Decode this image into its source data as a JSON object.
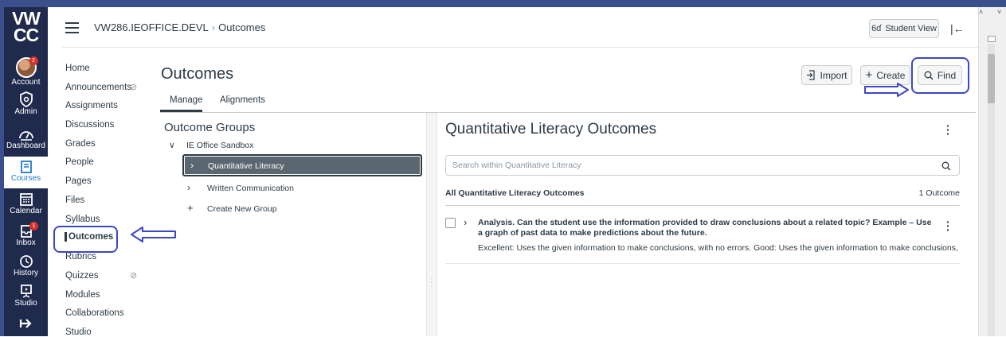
{
  "global_nav": {
    "logo": "VWCC",
    "items": [
      {
        "label": "Account",
        "icon": "avatar",
        "badge": "2"
      },
      {
        "label": "Admin",
        "icon": "shield-icon"
      },
      {
        "label": "Dashboard",
        "icon": "dashboard-icon"
      },
      {
        "label": "Courses",
        "icon": "book-icon",
        "active": true
      },
      {
        "label": "Calendar",
        "icon": "calendar-icon"
      },
      {
        "label": "Inbox",
        "icon": "inbox-icon",
        "badge": "1"
      },
      {
        "label": "History",
        "icon": "clock-icon"
      },
      {
        "label": "Studio",
        "icon": "studio-icon"
      },
      {
        "label": "",
        "icon": "arrow-right-icon"
      }
    ]
  },
  "header": {
    "course": "VW286.IEOFFICE.DEVL",
    "separator": "›",
    "current": "Outcomes",
    "student_view_icon": "glasses-icon",
    "student_view": "Student View",
    "collapse_icon": "collapse-arrow-icon"
  },
  "course_nav": {
    "items": [
      "Home",
      "Announcements",
      "Assignments",
      "Discussions",
      "Grades",
      "People",
      "Pages",
      "Files",
      "Syllabus",
      "Outcomes",
      "Rubrics",
      "Quizzes",
      "Modules",
      "Collaborations",
      "Studio"
    ],
    "active": "Outcomes",
    "hidden_icon": "eye-slash-icon"
  },
  "page": {
    "title": "Outcomes",
    "tabs": [
      "Manage",
      "Alignments"
    ],
    "active_tab": "Manage",
    "import": "Import",
    "create": "Create",
    "find": "Find"
  },
  "groups": {
    "title": "Outcome Groups",
    "root": "IE Office Sandbox",
    "children": [
      "Quantitative Literacy",
      "Written Communication"
    ],
    "create_new": "Create New Group"
  },
  "detail": {
    "title": "Quantitative Literacy Outcomes",
    "search_placeholder": "Search within Quantitative Literacy",
    "all_label": "All Quantitative Literacy Outcomes",
    "count": "1 Outcome",
    "outcome": {
      "title": "Analysis. Can the student use the information provided to draw conclusions about a related topic? Example – Use a graph of past data to make predictions about the future.",
      "description": "Excellent: Uses the given information to make conclusions, with no errors. Good: Uses the given information to make conclusions, ..."
    }
  },
  "colors": {
    "nav_bg": "#1f2a4d",
    "active_blue": "#1f79c8",
    "annotation": "#3d46c6",
    "selected_row": "#5b6770"
  }
}
